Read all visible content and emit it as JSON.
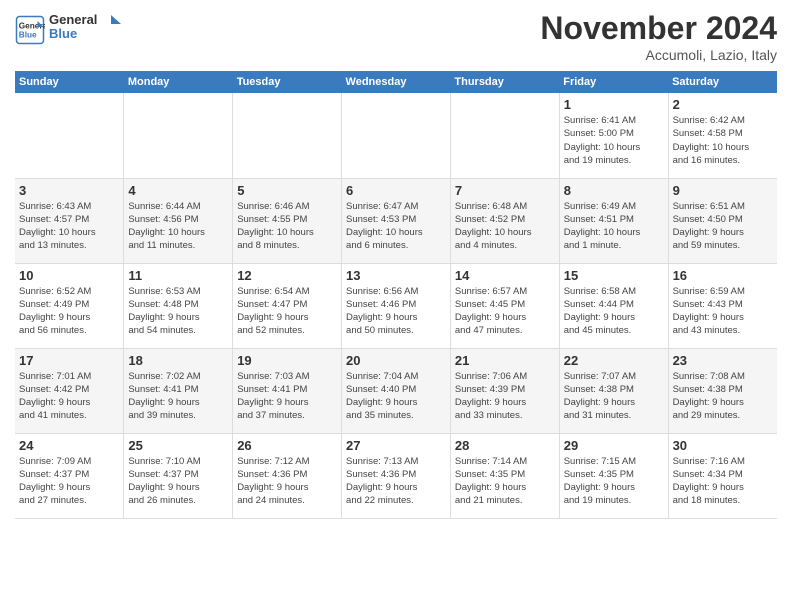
{
  "header": {
    "logo_line1": "General",
    "logo_line2": "Blue",
    "month": "November 2024",
    "location": "Accumoli, Lazio, Italy"
  },
  "weekdays": [
    "Sunday",
    "Monday",
    "Tuesday",
    "Wednesday",
    "Thursday",
    "Friday",
    "Saturday"
  ],
  "weeks": [
    [
      {
        "day": "",
        "info": ""
      },
      {
        "day": "",
        "info": ""
      },
      {
        "day": "",
        "info": ""
      },
      {
        "day": "",
        "info": ""
      },
      {
        "day": "",
        "info": ""
      },
      {
        "day": "1",
        "info": "Sunrise: 6:41 AM\nSunset: 5:00 PM\nDaylight: 10 hours\nand 19 minutes."
      },
      {
        "day": "2",
        "info": "Sunrise: 6:42 AM\nSunset: 4:58 PM\nDaylight: 10 hours\nand 16 minutes."
      }
    ],
    [
      {
        "day": "3",
        "info": "Sunrise: 6:43 AM\nSunset: 4:57 PM\nDaylight: 10 hours\nand 13 minutes."
      },
      {
        "day": "4",
        "info": "Sunrise: 6:44 AM\nSunset: 4:56 PM\nDaylight: 10 hours\nand 11 minutes."
      },
      {
        "day": "5",
        "info": "Sunrise: 6:46 AM\nSunset: 4:55 PM\nDaylight: 10 hours\nand 8 minutes."
      },
      {
        "day": "6",
        "info": "Sunrise: 6:47 AM\nSunset: 4:53 PM\nDaylight: 10 hours\nand 6 minutes."
      },
      {
        "day": "7",
        "info": "Sunrise: 6:48 AM\nSunset: 4:52 PM\nDaylight: 10 hours\nand 4 minutes."
      },
      {
        "day": "8",
        "info": "Sunrise: 6:49 AM\nSunset: 4:51 PM\nDaylight: 10 hours\nand 1 minute."
      },
      {
        "day": "9",
        "info": "Sunrise: 6:51 AM\nSunset: 4:50 PM\nDaylight: 9 hours\nand 59 minutes."
      }
    ],
    [
      {
        "day": "10",
        "info": "Sunrise: 6:52 AM\nSunset: 4:49 PM\nDaylight: 9 hours\nand 56 minutes."
      },
      {
        "day": "11",
        "info": "Sunrise: 6:53 AM\nSunset: 4:48 PM\nDaylight: 9 hours\nand 54 minutes."
      },
      {
        "day": "12",
        "info": "Sunrise: 6:54 AM\nSunset: 4:47 PM\nDaylight: 9 hours\nand 52 minutes."
      },
      {
        "day": "13",
        "info": "Sunrise: 6:56 AM\nSunset: 4:46 PM\nDaylight: 9 hours\nand 50 minutes."
      },
      {
        "day": "14",
        "info": "Sunrise: 6:57 AM\nSunset: 4:45 PM\nDaylight: 9 hours\nand 47 minutes."
      },
      {
        "day": "15",
        "info": "Sunrise: 6:58 AM\nSunset: 4:44 PM\nDaylight: 9 hours\nand 45 minutes."
      },
      {
        "day": "16",
        "info": "Sunrise: 6:59 AM\nSunset: 4:43 PM\nDaylight: 9 hours\nand 43 minutes."
      }
    ],
    [
      {
        "day": "17",
        "info": "Sunrise: 7:01 AM\nSunset: 4:42 PM\nDaylight: 9 hours\nand 41 minutes."
      },
      {
        "day": "18",
        "info": "Sunrise: 7:02 AM\nSunset: 4:41 PM\nDaylight: 9 hours\nand 39 minutes."
      },
      {
        "day": "19",
        "info": "Sunrise: 7:03 AM\nSunset: 4:41 PM\nDaylight: 9 hours\nand 37 minutes."
      },
      {
        "day": "20",
        "info": "Sunrise: 7:04 AM\nSunset: 4:40 PM\nDaylight: 9 hours\nand 35 minutes."
      },
      {
        "day": "21",
        "info": "Sunrise: 7:06 AM\nSunset: 4:39 PM\nDaylight: 9 hours\nand 33 minutes."
      },
      {
        "day": "22",
        "info": "Sunrise: 7:07 AM\nSunset: 4:38 PM\nDaylight: 9 hours\nand 31 minutes."
      },
      {
        "day": "23",
        "info": "Sunrise: 7:08 AM\nSunset: 4:38 PM\nDaylight: 9 hours\nand 29 minutes."
      }
    ],
    [
      {
        "day": "24",
        "info": "Sunrise: 7:09 AM\nSunset: 4:37 PM\nDaylight: 9 hours\nand 27 minutes."
      },
      {
        "day": "25",
        "info": "Sunrise: 7:10 AM\nSunset: 4:37 PM\nDaylight: 9 hours\nand 26 minutes."
      },
      {
        "day": "26",
        "info": "Sunrise: 7:12 AM\nSunset: 4:36 PM\nDaylight: 9 hours\nand 24 minutes."
      },
      {
        "day": "27",
        "info": "Sunrise: 7:13 AM\nSunset: 4:36 PM\nDaylight: 9 hours\nand 22 minutes."
      },
      {
        "day": "28",
        "info": "Sunrise: 7:14 AM\nSunset: 4:35 PM\nDaylight: 9 hours\nand 21 minutes."
      },
      {
        "day": "29",
        "info": "Sunrise: 7:15 AM\nSunset: 4:35 PM\nDaylight: 9 hours\nand 19 minutes."
      },
      {
        "day": "30",
        "info": "Sunrise: 7:16 AM\nSunset: 4:34 PM\nDaylight: 9 hours\nand 18 minutes."
      }
    ]
  ]
}
